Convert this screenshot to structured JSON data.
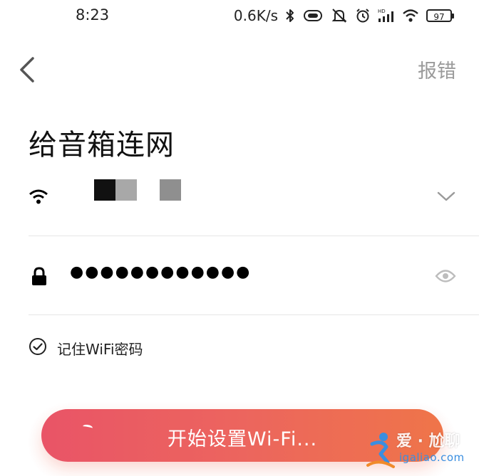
{
  "status_bar": {
    "time": "8:23",
    "net_speed": "0.6K/s",
    "battery_level": "97",
    "icons": [
      "bluetooth-icon",
      "vibrate-icon",
      "mute-icon",
      "alarm-icon",
      "signal-hd-icon",
      "wifi-icon",
      "battery-icon"
    ]
  },
  "header": {
    "report_label": "报错",
    "back_icon": "chevron-left-icon"
  },
  "page": {
    "title": "给音箱连网"
  },
  "wifi": {
    "icon": "wifi-icon",
    "ssid_obscured": true,
    "dropdown_icon": "chevron-down-icon"
  },
  "password": {
    "icon": "lock-icon",
    "value": "●●●●●●●●●●●●",
    "visibility_icon": "eye-icon"
  },
  "remember": {
    "checked": true,
    "label": "记住WiFi密码"
  },
  "action": {
    "start_label": "开始设置Wi-Fi...",
    "loading": true
  },
  "watermark": {
    "title": "爱 · 尬聊",
    "url": "igaliao.com"
  },
  "colors": {
    "accent_start": "#e8485c",
    "accent_end": "#ee6b3c",
    "muted_text": "#9a9a9a",
    "divider": "#e6e6e6"
  }
}
